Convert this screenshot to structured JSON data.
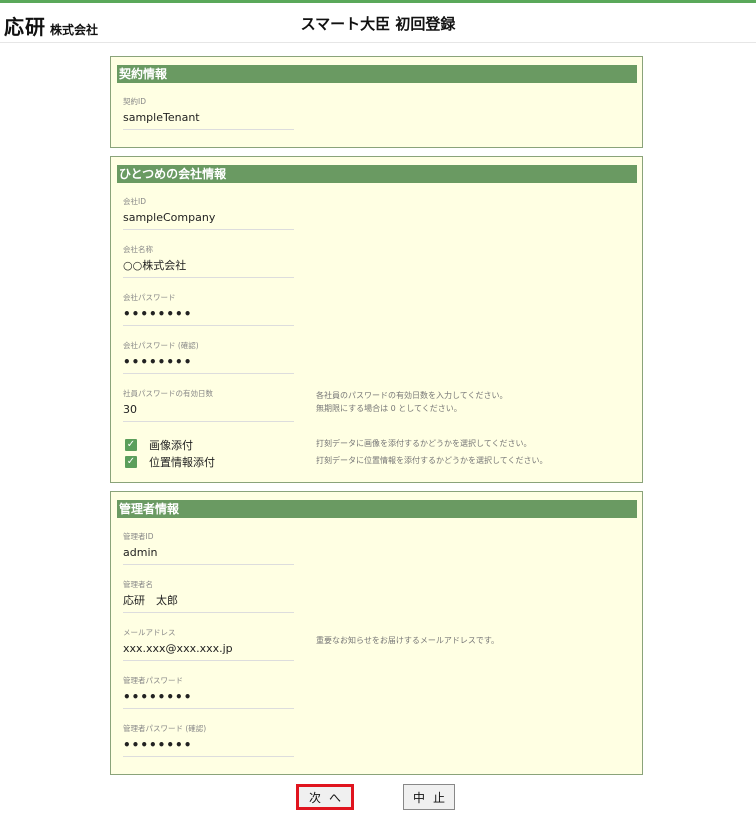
{
  "header": {
    "logo_main": "応研",
    "logo_sub": "株式会社",
    "title": "スマート大臣 初回登録"
  },
  "contract": {
    "heading": "契約情報",
    "contract_id_label": "契約ID",
    "contract_id_value": "sampleTenant"
  },
  "company": {
    "heading": "ひとつめの会社情報",
    "company_id_label": "会社ID",
    "company_id_value": "sampleCompany",
    "company_name_label": "会社名称",
    "company_name_value": "○○株式会社",
    "password_label": "会社パスワード",
    "password_value": "••••••••",
    "password_confirm_label": "会社パスワード (確認)",
    "password_confirm_value": "••••••••",
    "expiry_label": "社員パスワードの有効日数",
    "expiry_value": "30",
    "expiry_note_1": "各社員のパスワードの有効日数を入力してください。",
    "expiry_note_2": "無期限にする場合は 0 としてください。",
    "image_attach_label": "画像添付",
    "image_attach_checked": true,
    "image_attach_note": "打刻データに画像を添付するかどうかを選択してください。",
    "location_attach_label": "位置情報添付",
    "location_attach_checked": true,
    "location_attach_note": "打刻データに位置情報を添付するかどうかを選択してください。"
  },
  "admin": {
    "heading": "管理者情報",
    "admin_id_label": "管理者ID",
    "admin_id_value": "admin",
    "admin_name_label": "管理者名",
    "admin_name_value": "応研　太郎",
    "email_label": "メールアドレス",
    "email_value": "xxx.xxx@xxx.xxx.jp",
    "email_note": "重要なお知らせをお届けするメールアドレスです。",
    "password_label": "管理者パスワード",
    "password_value": "••••••••",
    "password_confirm_label": "管理者パスワード (確認)",
    "password_confirm_value": "••••••••"
  },
  "buttons": {
    "next": "次へ",
    "cancel": "中止"
  },
  "colors": {
    "section_bg": "#ffffe3",
    "section_header": "#6a9a62",
    "checkbox": "#5b9e5b",
    "highlight": "#e0141e",
    "top_bar": "#5aa85a"
  }
}
